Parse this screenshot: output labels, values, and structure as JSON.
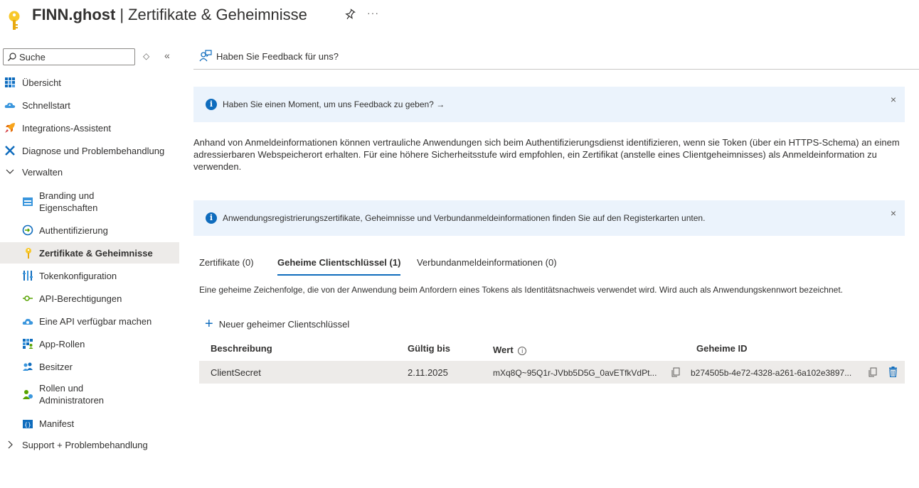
{
  "header": {
    "app_name": "FINN.ghost",
    "separator": "|",
    "page_title": "Zertifikate & Geheimnisse",
    "more": "···"
  },
  "sidebar": {
    "search_placeholder": "Suche",
    "updown": "◇",
    "collapse": "«",
    "items": [
      {
        "label": "Übersicht",
        "icon": "grid-icon"
      },
      {
        "label": "Schnellstart",
        "icon": "cloud-icon"
      },
      {
        "label": "Integrations-Assistent",
        "icon": "rocket-icon"
      },
      {
        "label": "Diagnose und Problembehandlung",
        "icon": "wrench-icon"
      },
      {
        "label": "Verwalten",
        "icon": "chevron-down-icon"
      },
      {
        "label": "Branding und\nEigenschaften",
        "icon": "branding-icon"
      },
      {
        "label": "Authentifizierung",
        "icon": "auth-icon"
      },
      {
        "label": "Zertifikate & Geheimnisse",
        "icon": "key-icon"
      },
      {
        "label": "Tokenkonfiguration",
        "icon": "token-bars-icon"
      },
      {
        "label": "API-Berechtigungen",
        "icon": "api-permissions-icon"
      },
      {
        "label": "Eine API verfügbar machen",
        "icon": "cloud-api-icon"
      },
      {
        "label": "App-Rollen",
        "icon": "app-roles-icon"
      },
      {
        "label": "Besitzer",
        "icon": "users-icon"
      },
      {
        "label": "Rollen und\nAdministratoren",
        "icon": "admin-user-icon"
      },
      {
        "label": "Manifest",
        "icon": "manifest-icon"
      },
      {
        "label": "Support + Problembehandlung",
        "icon": "chevron-right-icon"
      }
    ]
  },
  "main": {
    "feedback_cmd": "Haben Sie Feedback für uns?",
    "info1": "Haben Sie einen Moment, um uns Feedback zu geben? →",
    "description": "Anhand von Anmeldeinformationen können vertrauliche Anwendungen sich beim Authentifizierungsdienst identifizieren, wenn sie Token (über ein HTTPS-Schema) an einem adressierbaren Webspeicherort erhalten. Für eine höhere Sicherheitsstufe wird empfohlen, ein Zertifikat (anstelle eines Clientgeheimnisses) als Anmeldeinformation zu verwenden.",
    "info2": "Anwendungsregistrierungszertifikate, Geheimnisse und Verbundanmeldeinformationen finden Sie auf den Registerkarten unten.",
    "close": "×",
    "tabs": [
      {
        "label": "Zertifikate (0)"
      },
      {
        "label": "Geheime Clientschlüssel (1)"
      },
      {
        "label": "Verbundanmeldeinformationen (0)"
      }
    ],
    "tab_description": "Eine geheime Zeichenfolge, die von der Anwendung beim Anfordern eines Tokens als Identitätsnachweis verwendet wird. Wird auch als Anwendungskennwort bezeichnet.",
    "add_plus": "+",
    "add_label": "Neuer geheimer Clientschlüssel",
    "table": {
      "headers": {
        "desc": "Beschreibung",
        "expires": "Gültig bis",
        "value": "Wert",
        "value_info": "i",
        "id": "Geheime ID"
      },
      "rows": [
        {
          "desc": "ClientSecret",
          "expires": "2.11.2025",
          "value": "mXq8Q~95Q1r-JVbb5D5G_0avETfkVdPt...",
          "id": "b274505b-4e72-4328-a261-6a102e3897..."
        }
      ]
    }
  }
}
